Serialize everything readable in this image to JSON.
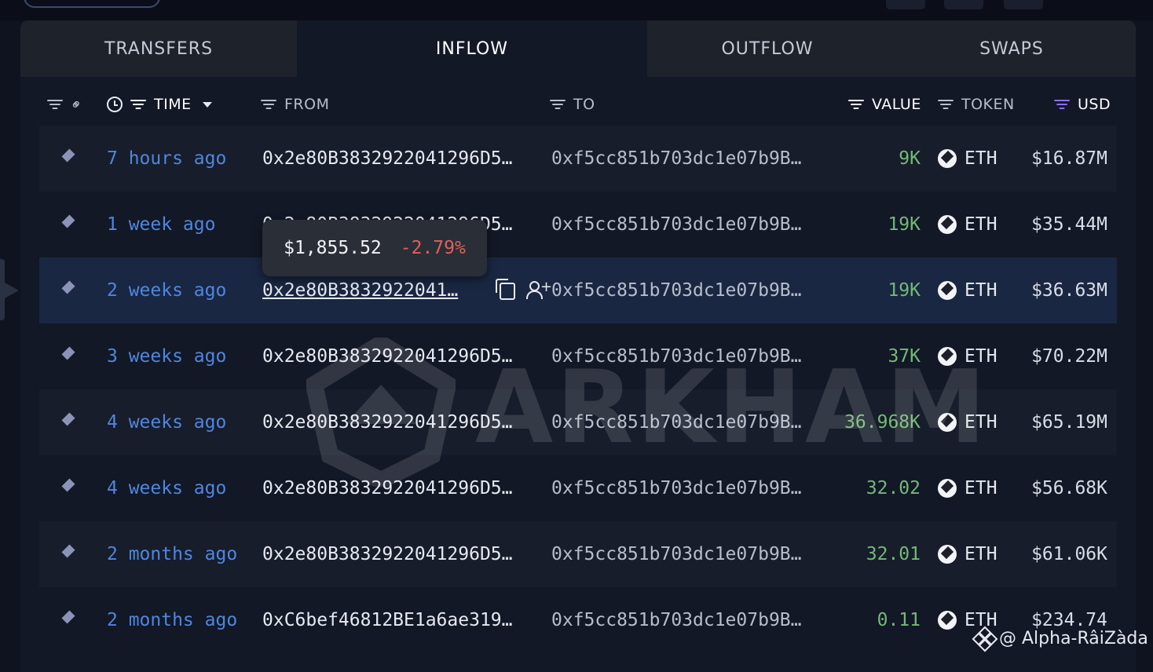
{
  "tabs": [
    "TRANSFERS",
    "INFLOW",
    "OUTFLOW",
    "SWAPS"
  ],
  "active_tab": "INFLOW",
  "columns": {
    "time": "TIME",
    "from": "FROM",
    "to": "TO",
    "value": "VALUE",
    "token": "TOKEN",
    "usd": "USD"
  },
  "tooltip": {
    "price": "$1,855.52",
    "change": "-2.79%"
  },
  "rows": [
    {
      "time": "7 hours ago",
      "from": "0x2e80B3832922041296D5…",
      "to": "0xf5cc851b703dc1e07b9B…",
      "value": "9K",
      "token": "ETH",
      "usd": "$16.87M"
    },
    {
      "time": "1 week ago",
      "from": "0x2e80B3832922041296D5…",
      "to": "0xf5cc851b703dc1e07b9B…",
      "value": "19K",
      "token": "ETH",
      "usd": "$35.44M"
    },
    {
      "time": "2 weeks ago",
      "from": "0x2e80B3832922041…",
      "to": "0xf5cc851b703dc1e07b9B…",
      "value": "19K",
      "token": "ETH",
      "usd": "$36.63M"
    },
    {
      "time": "3 weeks ago",
      "from": "0x2e80B3832922041296D5…",
      "to": "0xf5cc851b703dc1e07b9B…",
      "value": "37K",
      "token": "ETH",
      "usd": "$70.22M"
    },
    {
      "time": "4 weeks ago",
      "from": "0x2e80B3832922041296D5…",
      "to": "0xf5cc851b703dc1e07b9B…",
      "value": "36.968K",
      "token": "ETH",
      "usd": "$65.19M"
    },
    {
      "time": "4 weeks ago",
      "from": "0x2e80B3832922041296D5…",
      "to": "0xf5cc851b703dc1e07b9B…",
      "value": "32.02",
      "token": "ETH",
      "usd": "$56.68K"
    },
    {
      "time": "2 months ago",
      "from": "0x2e80B3832922041296D5…",
      "to": "0xf5cc851b703dc1e07b9B…",
      "value": "32.01",
      "token": "ETH",
      "usd": "$61.06K"
    },
    {
      "time": "2 months ago",
      "from": "0xC6bef46812BE1a6ae319…",
      "to": "0xf5cc851b703dc1e07b9B…",
      "value": "0.11",
      "token": "ETH",
      "usd": "$234.74"
    }
  ],
  "highlighted_row": 2,
  "watermark": "ARKHAM",
  "credit": "@ Alpha-RâiZàda",
  "colors": {
    "time_link": "#4f86e0",
    "value_green": "#74b876",
    "negative_red": "#e0605a",
    "usd_sort_accent": "#8b6ff0",
    "highlight_row": "#1a2742"
  },
  "icons": {
    "filter": "filter-icon",
    "link": "link-icon",
    "clock": "clock-icon",
    "sort_desc": "caret-down-icon",
    "chain": "ethereum-icon",
    "token": "eth-coin-icon",
    "copy": "copy-icon",
    "add_user": "user-plus-icon"
  }
}
